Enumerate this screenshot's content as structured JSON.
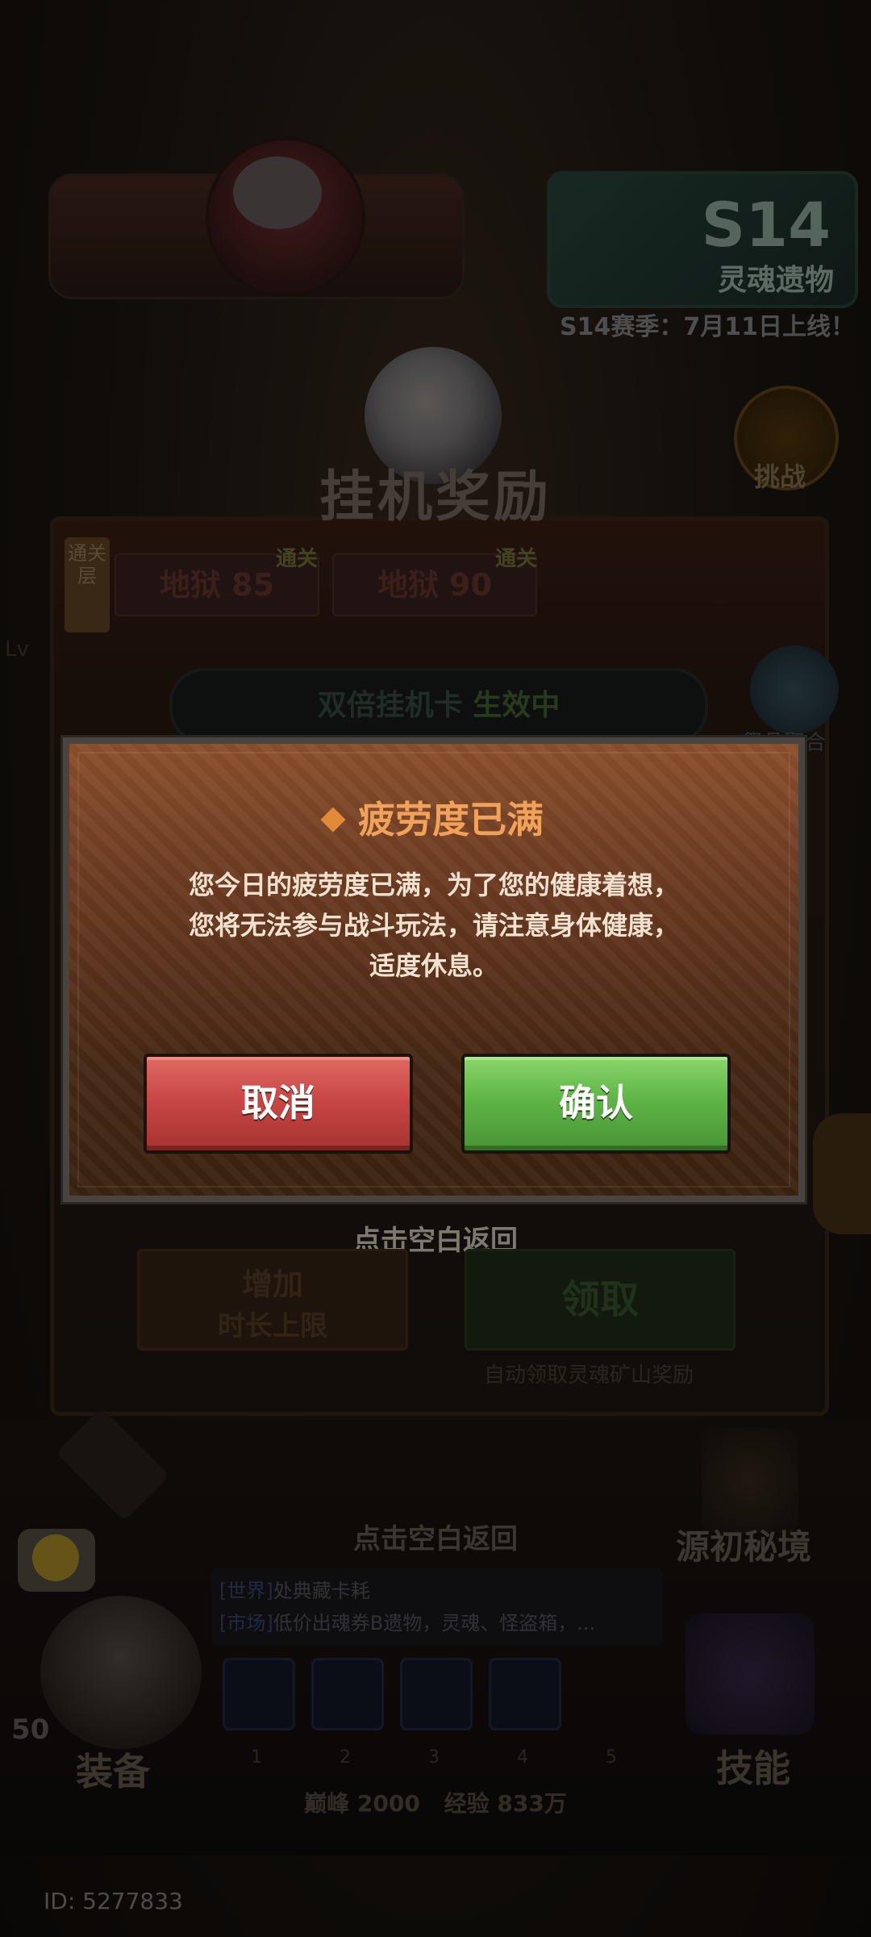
{
  "header": {
    "season_code": "S14",
    "season_subtitle": "灵魂遗物",
    "season_announcement": "S14赛季：7月11日上线！",
    "challenge_label": "挑战"
  },
  "afk_panel": {
    "title": "挂机奖励",
    "stage_tag": "通关层",
    "stages": [
      {
        "name": "地狱 85",
        "flag": "通关"
      },
      {
        "name": "地狱 90",
        "flag": "通关"
      }
    ],
    "double_card": "双倍挂机卡",
    "double_card_status": "生效中",
    "side_lv": "Lv",
    "side_fx_label": "祭品聚合",
    "increase_button": {
      "line1": "增加",
      "line2": "时长上限"
    },
    "claim_button": "领取",
    "auto_claim_note": "自动领取灵魂矿山奖励",
    "back_hint": "点击空白返回"
  },
  "modal": {
    "title": "疲劳度已满",
    "body_lines": [
      "您今日的疲劳度已满，为了您的健康着想，",
      "您将无法参与战斗玩法，请注意身体健康，",
      "适度休息。"
    ],
    "cancel_label": "取消",
    "confirm_label": "确认"
  },
  "bottom": {
    "back_hint": "点击空白返回",
    "mirror_label": "源初秘境",
    "chat": [
      {
        "channel": "[世界]",
        "text": "处典藏卡耗"
      },
      {
        "channel": "[市场]",
        "text": "低价出魂券B遗物，灵魂、怪盗箱，..."
      }
    ],
    "level": "50",
    "equip_label": "装备",
    "skill_label": "技能",
    "slot_numbers": [
      "1",
      "2",
      "3",
      "4",
      "5"
    ],
    "peak_label": "巅峰 2000",
    "exp_label": "经验 833万",
    "user_id": "ID: 5277833"
  },
  "colors": {
    "cancel": "#c94744",
    "confirm": "#5fb546",
    "modal_title": "#f0a25a"
  }
}
